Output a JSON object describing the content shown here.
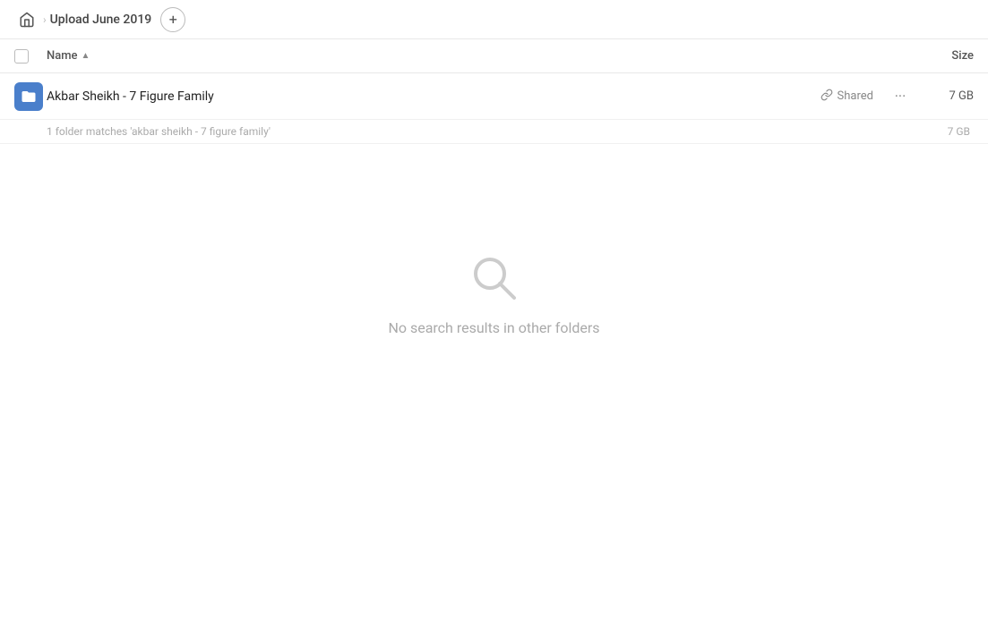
{
  "topbar": {
    "breadcrumb_label": "Upload June 2019",
    "add_button_label": "+"
  },
  "table_header": {
    "name_label": "Name",
    "size_label": "Size"
  },
  "file_row": {
    "name": "Akbar Sheikh - 7 Figure Family",
    "shared_label": "Shared",
    "size": "7 GB",
    "more_label": "···"
  },
  "match_row": {
    "text": "1 folder matches 'akbar sheikh - 7 figure family'",
    "size": "7 GB"
  },
  "no_results": {
    "text": "No search results in other folders"
  },
  "icons": {
    "home": "⌂",
    "chevron": "›",
    "link": "🔗",
    "folder": "✦",
    "more": "···"
  }
}
